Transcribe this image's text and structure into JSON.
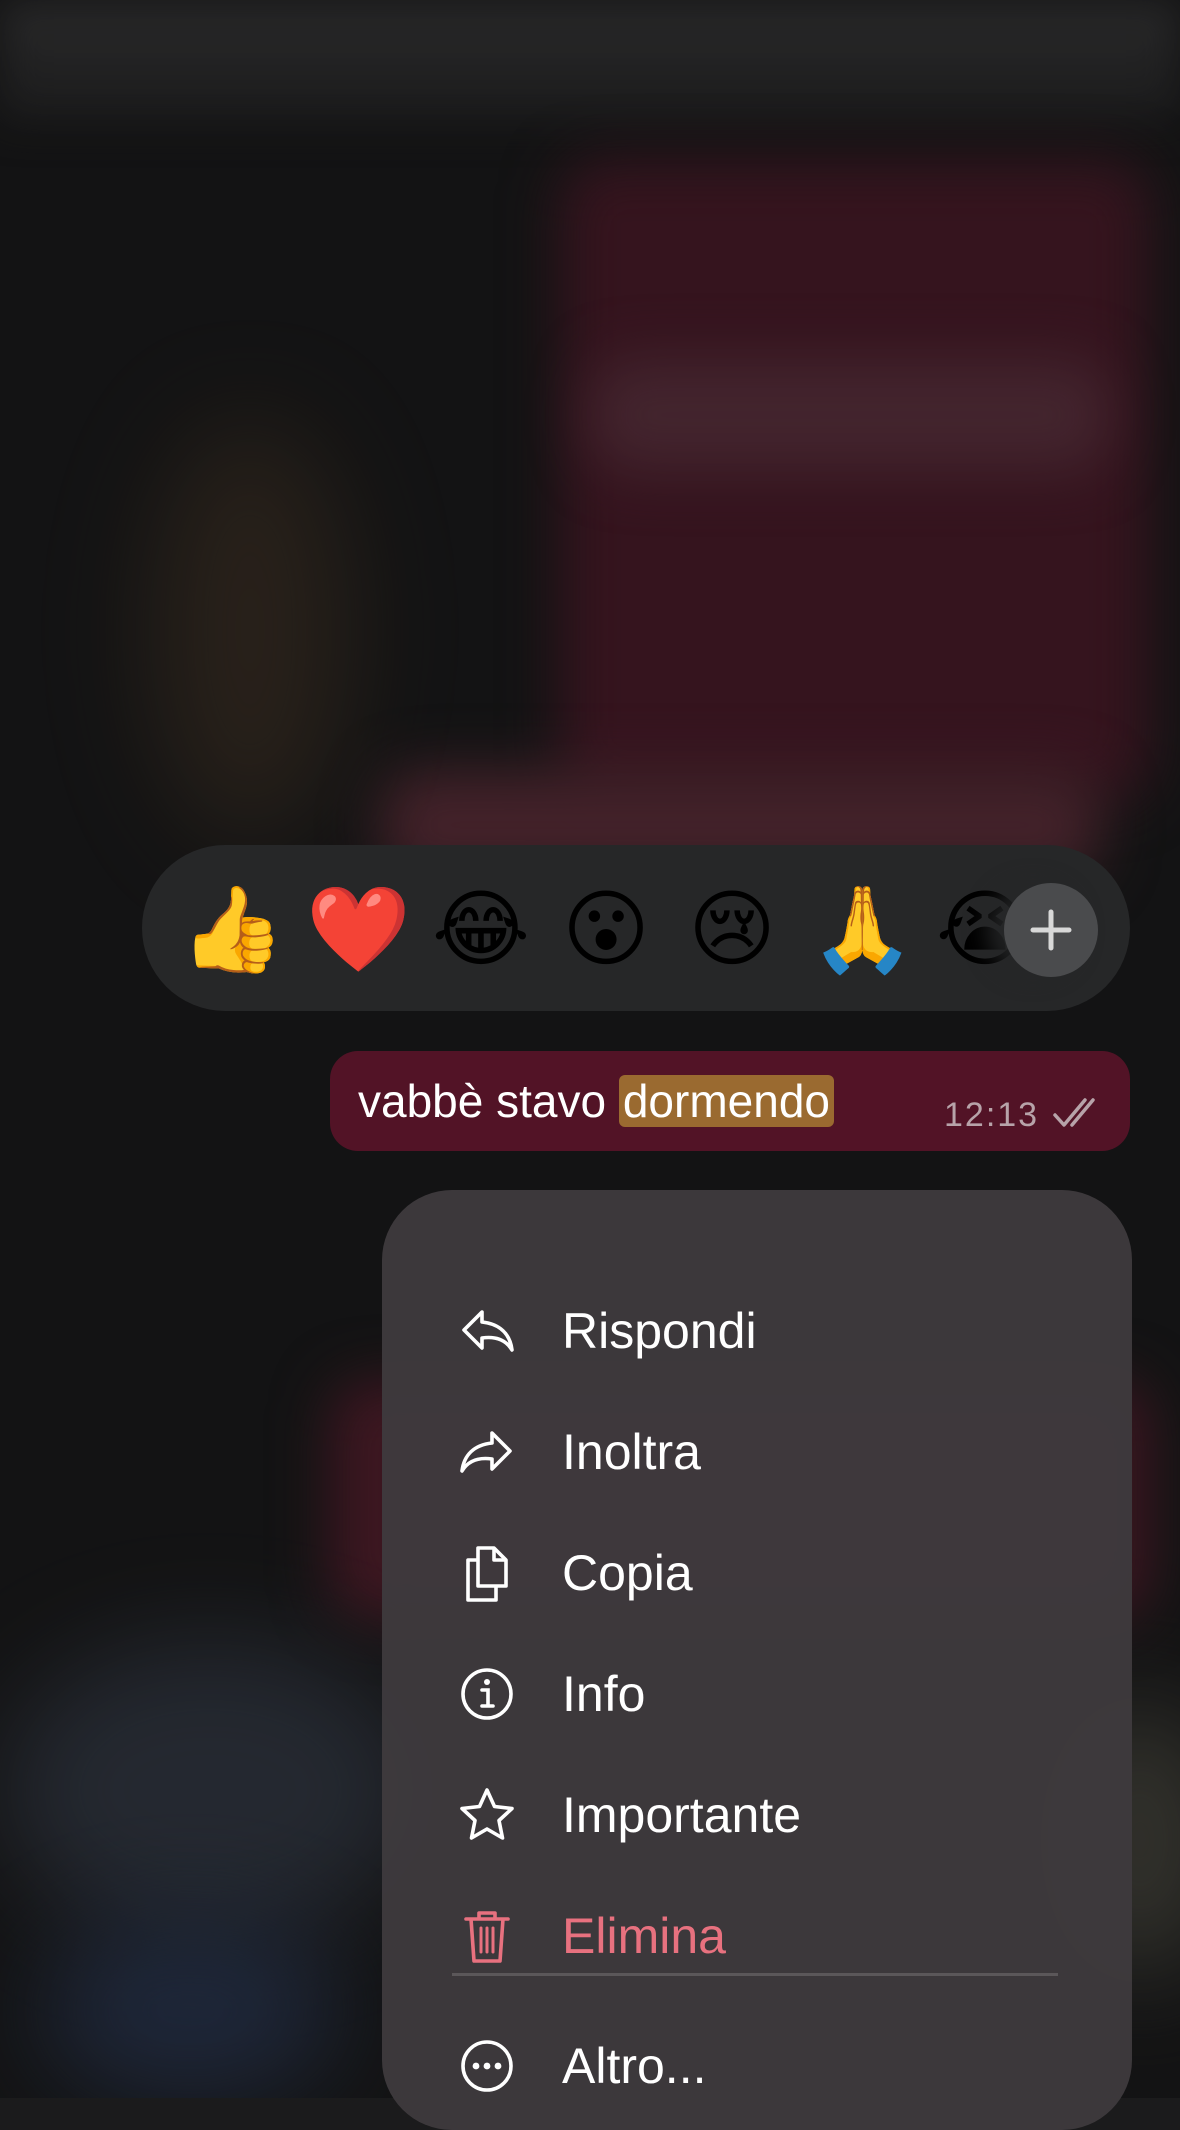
{
  "reactions": {
    "emojis": [
      {
        "name": "thumbs-up-emoji",
        "glyph": "👍"
      },
      {
        "name": "red-heart-emoji",
        "glyph": "❤️"
      },
      {
        "name": "tears-of-joy-emoji",
        "glyph": "😂"
      },
      {
        "name": "surprised-emoji",
        "glyph": "😮"
      },
      {
        "name": "sad-tear-emoji",
        "glyph": "😢"
      },
      {
        "name": "folded-hands-emoji",
        "glyph": "🙏"
      },
      {
        "name": "loudly-crying-emoji",
        "glyph": "😭"
      }
    ],
    "more_icon": "plus-icon"
  },
  "message": {
    "text_before": "vabbè stavo ",
    "text_highlighted": "dormendo",
    "time": "12:13",
    "status_icon": "double-check-icon"
  },
  "menu": {
    "items": [
      {
        "label": "Rispondi",
        "icon": "reply-icon"
      },
      {
        "label": "Inoltra",
        "icon": "forward-icon"
      },
      {
        "label": "Copia",
        "icon": "copy-icon"
      },
      {
        "label": "Info",
        "icon": "info-icon"
      },
      {
        "label": "Importante",
        "icon": "star-icon"
      },
      {
        "label": "Elimina",
        "icon": "trash-icon"
      }
    ],
    "more": {
      "label": "Altro...",
      "icon": "more-icon"
    }
  },
  "colors": {
    "bubble": "#521326",
    "highlight": "#9a6a30",
    "danger": "#e8717f",
    "menu_bg": "#3e3a3d",
    "reaction_bar": "#262728"
  }
}
